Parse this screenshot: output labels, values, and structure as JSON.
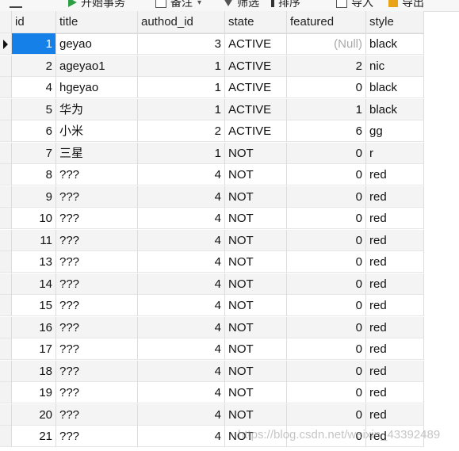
{
  "toolbar": {
    "begin_transaction": "开始事务",
    "note": "备注",
    "filter": "筛选",
    "sort": "排序",
    "import": "导入",
    "export": "导出"
  },
  "table": {
    "columns": [
      "id",
      "title",
      "authod_id",
      "state",
      "featured",
      "style"
    ],
    "rows": [
      {
        "id": "1",
        "title": "geyao",
        "authod_id": "3",
        "state": "ACTIVE",
        "featured": "(Null)",
        "style": "black"
      },
      {
        "id": "2",
        "title": "ageyao1",
        "authod_id": "1",
        "state": "ACTIVE",
        "featured": "2",
        "style": "nic"
      },
      {
        "id": "4",
        "title": "hgeyao",
        "authod_id": "1",
        "state": "ACTIVE",
        "featured": "0",
        "style": "black"
      },
      {
        "id": "5",
        "title": "华为",
        "authod_id": "1",
        "state": "ACTIVE",
        "featured": "1",
        "style": "black"
      },
      {
        "id": "6",
        "title": "小米",
        "authod_id": "2",
        "state": "ACTIVE",
        "featured": "6",
        "style": "gg"
      },
      {
        "id": "7",
        "title": "三星",
        "authod_id": "1",
        "state": "NOT",
        "featured": "0",
        "style": "r"
      },
      {
        "id": "8",
        "title": "???",
        "authod_id": "4",
        "state": "NOT",
        "featured": "0",
        "style": "red"
      },
      {
        "id": "9",
        "title": "???",
        "authod_id": "4",
        "state": "NOT",
        "featured": "0",
        "style": "red"
      },
      {
        "id": "10",
        "title": "???",
        "authod_id": "4",
        "state": "NOT",
        "featured": "0",
        "style": "red"
      },
      {
        "id": "11",
        "title": "???",
        "authod_id": "4",
        "state": "NOT",
        "featured": "0",
        "style": "red"
      },
      {
        "id": "13",
        "title": "???",
        "authod_id": "4",
        "state": "NOT",
        "featured": "0",
        "style": "red"
      },
      {
        "id": "14",
        "title": "???",
        "authod_id": "4",
        "state": "NOT",
        "featured": "0",
        "style": "red"
      },
      {
        "id": "15",
        "title": "???",
        "authod_id": "4",
        "state": "NOT",
        "featured": "0",
        "style": "red"
      },
      {
        "id": "16",
        "title": "???",
        "authod_id": "4",
        "state": "NOT",
        "featured": "0",
        "style": "red"
      },
      {
        "id": "17",
        "title": "???",
        "authod_id": "4",
        "state": "NOT",
        "featured": "0",
        "style": "red"
      },
      {
        "id": "18",
        "title": "???",
        "authod_id": "4",
        "state": "NOT",
        "featured": "0",
        "style": "red"
      },
      {
        "id": "19",
        "title": "???",
        "authod_id": "4",
        "state": "NOT",
        "featured": "0",
        "style": "red"
      },
      {
        "id": "20",
        "title": "???",
        "authod_id": "4",
        "state": "NOT",
        "featured": "0",
        "style": "red"
      },
      {
        "id": "21",
        "title": "???",
        "authod_id": "4",
        "state": "NOT",
        "featured": "0",
        "style": "red"
      }
    ]
  },
  "watermark": "https://blog.csdn.net/weixin_43392489",
  "colors": {
    "selection": "#1580e8",
    "null_text": "#a9a9a9",
    "zebra": "#f4f4f4"
  }
}
